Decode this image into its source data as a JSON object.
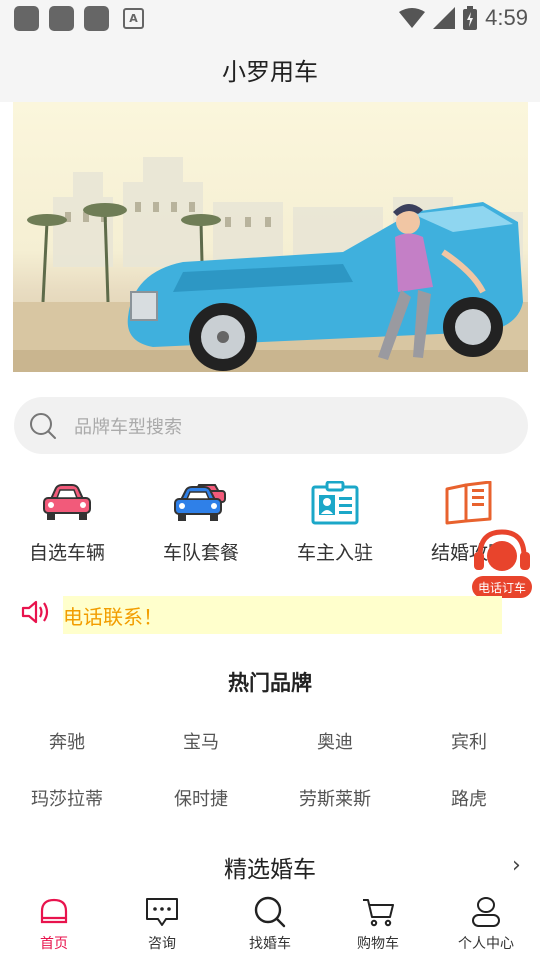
{
  "status_bar": {
    "time": "4:59",
    "notif_letter": "A"
  },
  "header": {
    "title": "小罗用车"
  },
  "search": {
    "placeholder": "品牌车型搜索"
  },
  "quick_links": [
    {
      "label": "自选车辆",
      "icon": "car-icon"
    },
    {
      "label": "车队套餐",
      "icon": "fleet-icon"
    },
    {
      "label": "车主入驻",
      "icon": "id-card-icon"
    },
    {
      "label": "结婚攻略",
      "icon": "book-icon"
    }
  ],
  "float_button": {
    "label": "电话订车"
  },
  "notice": {
    "text": "电话联系！"
  },
  "hot_brands": {
    "title": "热门品牌",
    "items": [
      "奔驰",
      "宝马",
      "奥迪",
      "宾利",
      "玛莎拉蒂",
      "保时捷",
      "劳斯莱斯",
      "路虎"
    ]
  },
  "featured": {
    "title": "精选婚车",
    "more": "›"
  },
  "tabbar": {
    "active_color": "#e8134d",
    "items": [
      {
        "label": "首页",
        "icon": "home-icon",
        "active": true
      },
      {
        "label": "咨询",
        "icon": "chat-icon",
        "active": false
      },
      {
        "label": "找婚车",
        "icon": "search-icon",
        "active": false
      },
      {
        "label": "购物车",
        "icon": "cart-icon",
        "active": false
      },
      {
        "label": "个人中心",
        "icon": "user-icon",
        "active": false
      }
    ]
  }
}
